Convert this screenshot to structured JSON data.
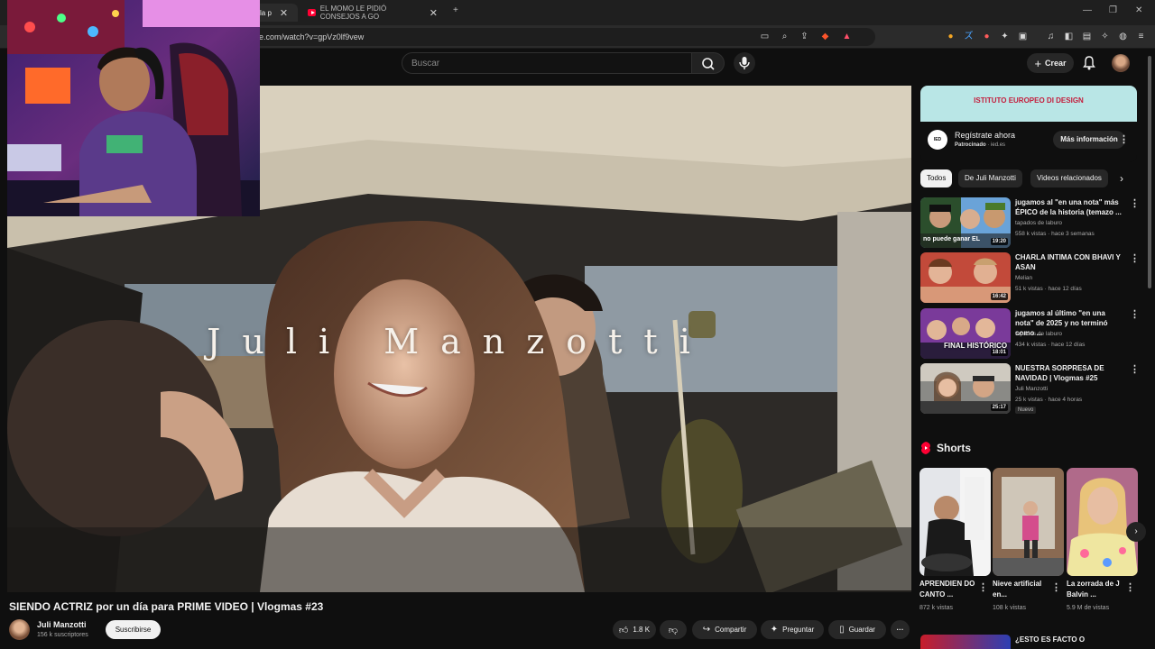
{
  "browser": {
    "tabs": [
      {
        "label": "la p",
        "active": true
      },
      {
        "label": "EL MOMO LE PIDIÓ CONSEJOS A GO",
        "active": false
      }
    ],
    "url": "e.com/watch?v=gpVz0lf9vew"
  },
  "youtube": {
    "search_placeholder": "Buscar",
    "create_label": "Crear"
  },
  "video": {
    "overlay_title": "Juli Manzotti",
    "title": "SIENDO ACTRIZ por un día para PRIME VIDEO | Vlogmas #23",
    "channel": "Juli Manzotti",
    "subscribers": "156 k suscriptores",
    "subscribe_label": "Suscribirse",
    "likes": "1.8 K",
    "share_label": "Compartir",
    "ask_label": "Preguntar",
    "save_label": "Guardar"
  },
  "ad": {
    "banner": "ISTITUTO EUROPEO DI DESIGN",
    "logo": "IED",
    "title": "Regístrate ahora",
    "sponsored": "Patrocinado",
    "domain": "· ied.es",
    "button": "Más información"
  },
  "chips": [
    "Todos",
    "De Juli Manzotti",
    "Videos relacionados"
  ],
  "related": [
    {
      "title": "jugamos al \"en una nota\" más ÉPICO de la historia (temazo ...",
      "channel": "tapados de laburo",
      "meta": "558 k vistas · hace 3 semanas",
      "duration": "19:20",
      "thumb_text": "no puede ganar EL",
      "badge": ""
    },
    {
      "title": "CHARLA INTIMA CON BHAVI Y ASAN",
      "channel": "Melian",
      "meta": "51 k vistas · hace 12 días",
      "duration": "16:42",
      "thumb_text": "",
      "badge": ""
    },
    {
      "title": "jugamos al último \"en una nota\" de 2025 y no terminó como ...",
      "channel": "tapados de laburo",
      "meta": "434 k vistas · hace 12 días",
      "duration": "18:01",
      "thumb_text": "FINAL HISTÓRICO",
      "badge": ""
    },
    {
      "title": "NUESTRA SORPRESA DE NAVIDAD | Vlogmas #25",
      "channel": "Juli Manzotti",
      "meta": "25 k vistas · hace 4 horas",
      "duration": "25:17",
      "thumb_text": "",
      "badge": "Nuevo"
    }
  ],
  "shorts": {
    "heading": "Shorts",
    "items": [
      {
        "title": "APRENDIEN DO CANTO ...",
        "views": "872 k vistas"
      },
      {
        "title": "Nieve artificial en...",
        "views": "108 k vistas"
      },
      {
        "title": "La zorrada de J Balvin ...",
        "views": "5.9 M de vistas"
      }
    ]
  },
  "next_related_title": "¿ESTO ES FACTO O",
  "colors": {
    "background": "#0f0f0f",
    "accent": "#ff0033",
    "chip_bg": "#272727"
  }
}
